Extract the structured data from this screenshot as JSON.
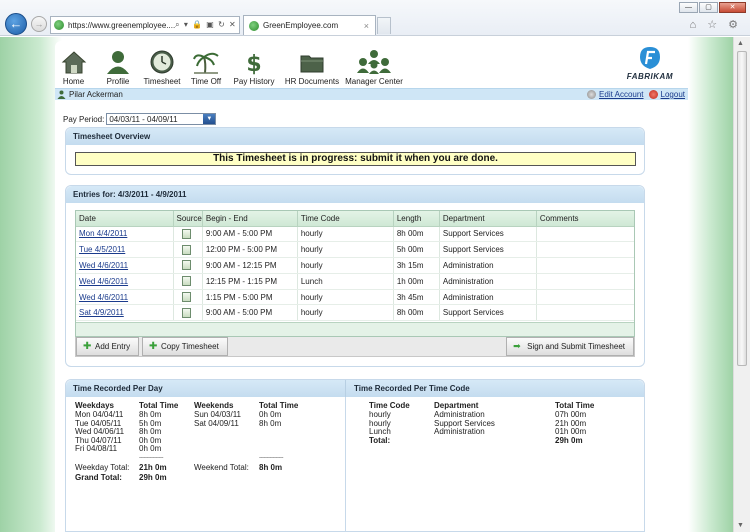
{
  "browser": {
    "url": "https://www.greenemployee....",
    "addr_icons": "⌕ ▾ 🔒 ▣ ↻ ✕",
    "tab_title": "GreenEmployee.com",
    "tab_close": "×",
    "window_controls": [
      "—",
      "▢",
      "✕"
    ],
    "toolbar_right": "⌂ ☆ ⚙"
  },
  "nav": {
    "items": [
      {
        "label": "Home",
        "icon": "home-icon"
      },
      {
        "label": "Profile",
        "icon": "profile-icon"
      },
      {
        "label": "Timesheet",
        "icon": "clock-icon"
      },
      {
        "label": "Time Off",
        "icon": "palm-tree-icon"
      },
      {
        "label": "Pay History",
        "icon": "dollar-icon"
      },
      {
        "label": "HR Documents",
        "icon": "folder-icon"
      },
      {
        "label": "Manager Center",
        "icon": "people-icon"
      }
    ],
    "logo_text": "FABRIKAM"
  },
  "userbar": {
    "user_name": "Pilar Ackerman",
    "edit_account": "Edit Account",
    "logout": "Logout"
  },
  "pay_period": {
    "label": "Pay Period:",
    "value": "04/03/11 - 04/09/11"
  },
  "overview": {
    "title": "Timesheet Overview",
    "message": "This Timesheet is in progress: submit it when you are done."
  },
  "entries": {
    "title": "Entries for: 4/3/2011 - 4/9/2011",
    "columns": [
      "Date",
      "Source",
      "Begin - End",
      "Time Code",
      "Length",
      "Department",
      "Comments"
    ],
    "rows": [
      {
        "date": "Mon 4/4/2011",
        "begin_end": "9:00 AM - 5:00 PM",
        "code": "hourly",
        "length": "8h 00m",
        "dept": "Support Services",
        "comments": ""
      },
      {
        "date": "Tue 4/5/2011",
        "begin_end": "12:00 PM - 5:00 PM",
        "code": "hourly",
        "length": "5h 00m",
        "dept": "Support Services",
        "comments": ""
      },
      {
        "date": "Wed 4/6/2011",
        "begin_end": "9:00 AM - 12:15 PM",
        "code": "hourly",
        "length": "3h 15m",
        "dept": "Administration",
        "comments": ""
      },
      {
        "date": "Wed 4/6/2011",
        "begin_end": "12:15 PM - 1:15 PM",
        "code": "Lunch",
        "length": "1h 00m",
        "dept": "Administration",
        "comments": ""
      },
      {
        "date": "Wed 4/6/2011",
        "begin_end": "1:15 PM - 5:00 PM",
        "code": "hourly",
        "length": "3h 45m",
        "dept": "Administration",
        "comments": ""
      },
      {
        "date": "Sat 4/9/2011",
        "begin_end": "9:00 AM - 5:00 PM",
        "code": "hourly",
        "length": "8h 00m",
        "dept": "Support Services",
        "comments": ""
      }
    ],
    "buttons": {
      "add_entry": "Add Entry",
      "copy_timesheet": "Copy Timesheet",
      "sign_submit": "Sign and Submit Timesheet"
    }
  },
  "per_day": {
    "title": "Time Recorded Per Day",
    "weekdays_header": "Weekdays",
    "total_time_header": "Total Time",
    "weekends_header": "Weekends",
    "weekend_total_time_header": "Total Time",
    "weekdays": [
      {
        "day": "Mon 04/04/11",
        "time": "8h 0m"
      },
      {
        "day": "Tue 04/05/11",
        "time": "5h 0m"
      },
      {
        "day": "Wed 04/06/11",
        "time": "8h 0m"
      },
      {
        "day": "Thu 04/07/11",
        "time": "0h 0m"
      },
      {
        "day": "Fri 04/08/11",
        "time": "0h 0m"
      }
    ],
    "weekends": [
      {
        "day": "Sun 04/03/11",
        "time": "0h 0m"
      },
      {
        "day": "Sat 04/09/11",
        "time": "8h 0m"
      }
    ],
    "separator": "----------------",
    "weekday_total_label": "Weekday Total:",
    "weekday_total": "21h 0m",
    "weekend_total_label": "Weekend Total:",
    "weekend_total": "8h 0m",
    "grand_total_label": "Grand Total:",
    "grand_total": "29h 0m"
  },
  "per_code": {
    "title": "Time Recorded Per Time Code",
    "headers": {
      "code": "Time Code",
      "dept": "Department",
      "total": "Total Time"
    },
    "rows": [
      {
        "code": "hourly",
        "dept": "Administration",
        "total": "07h 00m"
      },
      {
        "code": "hourly",
        "dept": "Support Services",
        "total": "21h 00m"
      },
      {
        "code": "Lunch",
        "dept": "Administration",
        "total": "01h 00m"
      }
    ],
    "total_label": "Total:",
    "total": "29h 0m"
  }
}
